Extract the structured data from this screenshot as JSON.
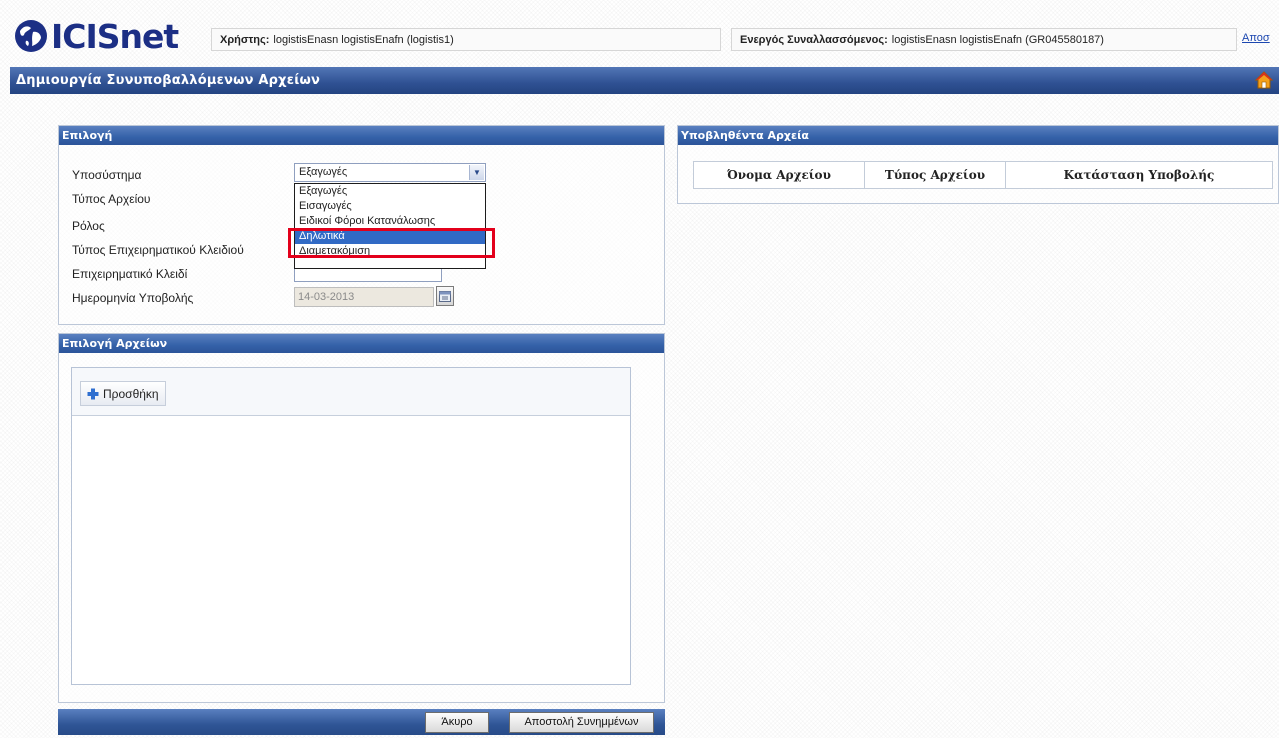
{
  "header": {
    "logo_text": "ICISnet",
    "user_label": "Χρήστης:",
    "user_value": "logistisEnasn logistisEnafn (logistis1)",
    "partner_label": "Ενεργός Συναλλασσόμενος:",
    "partner_value": "logistisEnasn logistisEnafn (GR045580187)",
    "logout_text": "Αποσ"
  },
  "page": {
    "title": "Δημιουργία Συνυποβαλλόμενων Αρχείων"
  },
  "selection_panel": {
    "title": "Επιλογή",
    "labels": {
      "subsystem": "Υποσύστημα",
      "file_type": "Τύπος Αρχείου",
      "role": "Ρόλος",
      "business_key_type": "Τύπος Επιχειρηματικού Κλειδιού",
      "business_key": "Επιχειρηματικό Κλειδί",
      "submission_date": "Ημερομηνία Υποβολής"
    },
    "subsystem_value": "Εξαγωγές",
    "subsystem_options": [
      "Εξαγωγές",
      "Εισαγωγές",
      "Ειδικοί Φόροι Κατανάλωσης",
      "Δηλωτικά",
      "Διαμετακόμιση"
    ],
    "selected_option_index": 3,
    "submission_date_value": "14-03-2013"
  },
  "files_panel": {
    "title": "Επιλογή Αρχείων",
    "add_label": "Προσθήκη"
  },
  "submitted_panel": {
    "title": "Υποβληθέντα Αρχεία",
    "columns": [
      "Όνομα Αρχείου",
      "Τύπος Αρχείου",
      "Κατάσταση Υποβολής"
    ]
  },
  "footer": {
    "cancel_label": "Άκυρο",
    "send_label": "Αποστολή Συνημμένων"
  },
  "colors": {
    "header_blue": "#2f5193",
    "logo_blue": "#1c2f85",
    "highlight_red": "#e3001b",
    "selected_option": "#316ac5"
  }
}
